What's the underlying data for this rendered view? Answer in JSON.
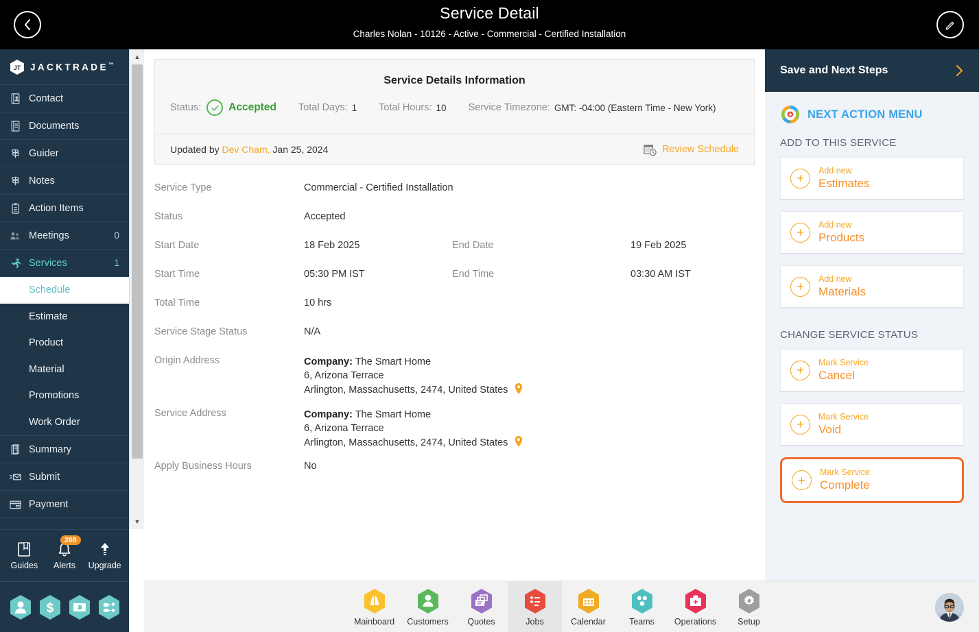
{
  "topbar": {
    "title": "Service Detail",
    "subtitle": "Charles Nolan - 10126 - Active - Commercial - Certified Installation",
    "back_icon": "chevron-left-icon",
    "edit_icon": "pencil-icon"
  },
  "sidebar": {
    "brand": "JACKTRADE",
    "brand_tm": "™",
    "items": [
      {
        "label": "Contact",
        "icon": "contact-card-icon",
        "count": ""
      },
      {
        "label": "Documents",
        "icon": "document-icon",
        "count": ""
      },
      {
        "label": "Guider",
        "icon": "signpost-icon",
        "count": ""
      },
      {
        "label": "Notes",
        "icon": "signpost-icon",
        "count": ""
      },
      {
        "label": "Action Items",
        "icon": "clipboard-icon",
        "count": ""
      },
      {
        "label": "Meetings",
        "icon": "meetings-icon",
        "count": "0"
      },
      {
        "label": "Services",
        "icon": "service-runner-icon",
        "count": "1"
      }
    ],
    "sub_items": [
      {
        "label": "Schedule",
        "selected": true
      },
      {
        "label": "Estimate",
        "selected": false
      },
      {
        "label": "Product",
        "selected": false
      },
      {
        "label": "Material",
        "selected": false
      },
      {
        "label": "Promotions",
        "selected": false
      },
      {
        "label": "Work Order",
        "selected": false
      }
    ],
    "items_after": [
      {
        "label": "Summary",
        "icon": "summary-icon",
        "count": ""
      },
      {
        "label": "Submit",
        "icon": "submit-mail-icon",
        "count": ""
      },
      {
        "label": "Payment",
        "icon": "payment-card-icon",
        "count": ""
      }
    ],
    "tools": [
      {
        "label": "Guides",
        "icon": "book-icon",
        "badge": ""
      },
      {
        "label": "Alerts",
        "icon": "bell-icon",
        "badge": "268"
      },
      {
        "label": "Upgrade",
        "icon": "up-arrow-icon",
        "badge": ""
      }
    ],
    "hex_shortcuts": [
      {
        "name": "person-hex-icon"
      },
      {
        "name": "dollar-hex-icon"
      },
      {
        "name": "money-transfer-hex-icon"
      },
      {
        "name": "workflow-hex-icon"
      }
    ]
  },
  "info_card": {
    "title": "Service Details Information",
    "status_label": "Status:",
    "status_value": "Accepted",
    "total_days_label": "Total Days:",
    "total_days_value": "1",
    "total_hours_label": "Total Hours:",
    "total_hours_value": "10",
    "timezone_label": "Service Timezone:",
    "timezone_value": "GMT: -04:00 (Eastern Time - New York)",
    "updated_prefix": "Updated by",
    "updated_by": "Dev Cham,",
    "updated_date": "Jan 25, 2024",
    "review_schedule": "Review Schedule",
    "review_icon": "calendar-clock-icon"
  },
  "fields": {
    "service_type_label": "Service Type",
    "service_type_value": "Commercial - Certified Installation",
    "status_label": "Status",
    "status_value": "Accepted",
    "start_date_label": "Start Date",
    "start_date_value": "18 Feb 2025",
    "end_date_label": "End Date",
    "end_date_value": "19 Feb 2025",
    "start_time_label": "Start Time",
    "start_time_value": "05:30 PM IST",
    "end_time_label": "End Time",
    "end_time_value": "03:30 AM IST",
    "total_time_label": "Total Time",
    "total_time_value": "10 hrs",
    "stage_status_label": "Service Stage Status",
    "stage_status_value": "N/A",
    "origin_address_label": "Origin Address",
    "service_address_label": "Service Address",
    "company_label": "Company:",
    "company_name": "The Smart Home",
    "street": "6, Arizona Terrace",
    "city_line": "Arlington, Massachusetts, 2474, United States",
    "map_pin_icon": "map-pin-icon",
    "business_hours_label": "Apply Business Hours",
    "business_hours_value": "No"
  },
  "right_panel": {
    "header_title": "Save and Next Steps",
    "header_chevron": "chevron-right-icon",
    "menu_icon": "gear-cycle-icon",
    "menu_title": "NEXT ACTION MENU",
    "add_section_label": "ADD TO THIS SERVICE",
    "add_actions": [
      {
        "small": "Add new",
        "large": "Estimates",
        "highlight": false
      },
      {
        "small": "Add new",
        "large": "Products",
        "highlight": false
      },
      {
        "small": "Add new",
        "large": "Materials",
        "highlight": false
      }
    ],
    "status_section_label": "CHANGE SERVICE STATUS",
    "status_actions": [
      {
        "small": "Mark Service",
        "large": "Cancel",
        "highlight": false
      },
      {
        "small": "Mark Service",
        "large": "Void",
        "highlight": false
      },
      {
        "small": "Mark Service",
        "large": "Complete",
        "highlight": true
      }
    ],
    "plus_icon": "plus-circle-icon"
  },
  "bottom_nav": {
    "items": [
      {
        "label": "Mainboard",
        "icon": "mainboard-hex-icon",
        "color": "#fbc02d",
        "active": false
      },
      {
        "label": "Customers",
        "icon": "customers-hex-icon",
        "color": "#5cb85c",
        "active": false
      },
      {
        "label": "Quotes",
        "icon": "quotes-hex-icon",
        "color": "#9b72c4",
        "active": false
      },
      {
        "label": "Jobs",
        "icon": "jobs-hex-icon",
        "color": "#e74c3c",
        "active": true
      },
      {
        "label": "Calendar",
        "icon": "calendar-hex-icon",
        "color": "#f0ab26",
        "active": false
      },
      {
        "label": "Teams",
        "icon": "teams-hex-icon",
        "color": "#4ebfc0",
        "active": false
      },
      {
        "label": "Operations",
        "icon": "operations-hex-icon",
        "color": "#e8345a",
        "active": false
      },
      {
        "label": "Setup",
        "icon": "setup-hex-icon",
        "color": "#9e9e9e",
        "active": false
      }
    ],
    "avatar_icon": "user-avatar"
  },
  "colors": {
    "navy": "#1f3648",
    "orange": "#f5a623",
    "accent_orange": "#ef6b2c",
    "green": "#3c9c38",
    "blue": "#3aa4e8",
    "teal": "#5fd0cf"
  }
}
